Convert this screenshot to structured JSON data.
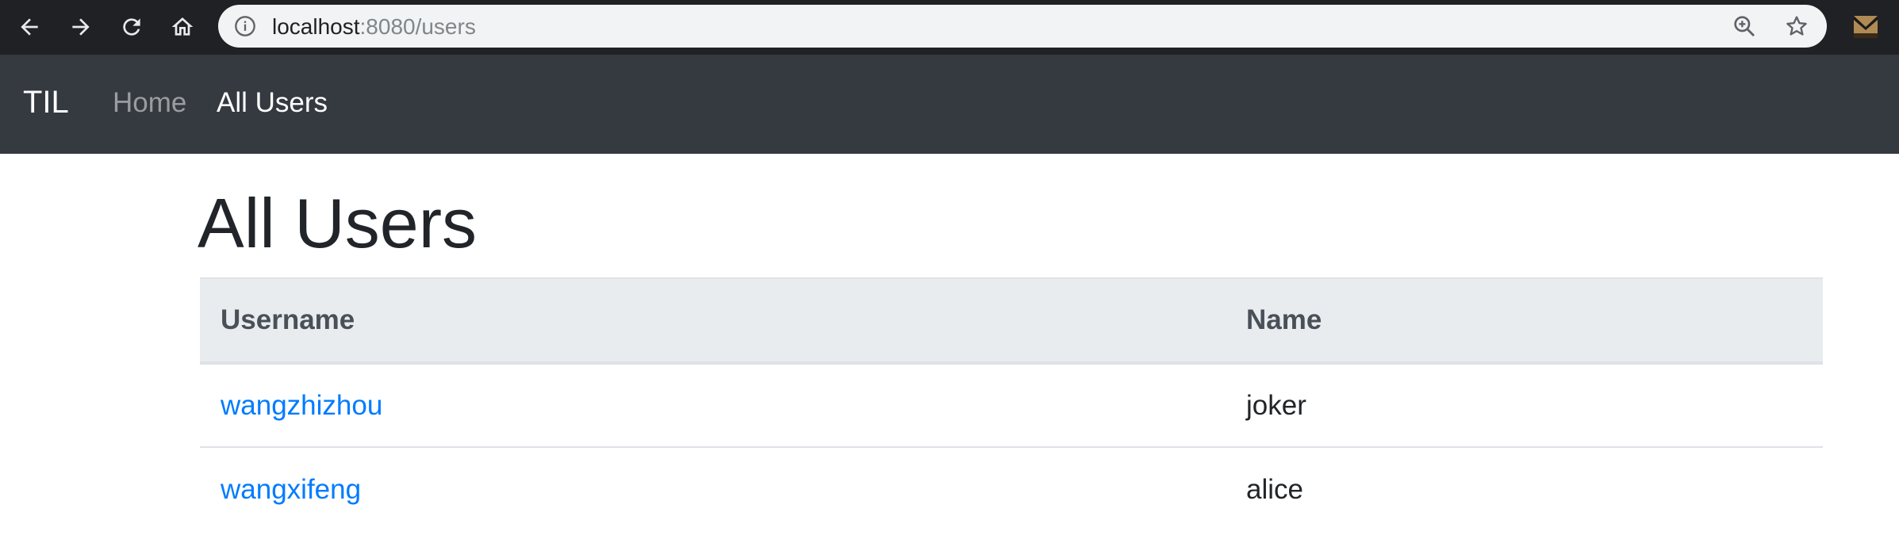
{
  "browser": {
    "url_host": "localhost",
    "url_rest": ":8080/users",
    "icons": {
      "back": "arrow-left-icon",
      "forward": "arrow-right-icon",
      "reload": "reload-icon",
      "home": "home-icon",
      "info": "info-icon",
      "zoom": "zoom-in-icon",
      "bookmark": "star-icon",
      "extension": "extension-icon"
    }
  },
  "navbar": {
    "brand": "TIL",
    "links": [
      {
        "label": "Home",
        "active": false
      },
      {
        "label": "All Users",
        "active": true
      }
    ]
  },
  "main": {
    "title": "All Users",
    "table": {
      "headers": [
        "Username",
        "Name"
      ],
      "rows": [
        {
          "username": "wangzhizhou",
          "name": "joker"
        },
        {
          "username": "wangxifeng",
          "name": "alice"
        }
      ]
    }
  },
  "colors": {
    "chrome_bg": "#202124",
    "navbar_bg": "#343a40",
    "link": "#007bff",
    "table_header_bg": "#e9ecef",
    "title_text": "#212529"
  }
}
